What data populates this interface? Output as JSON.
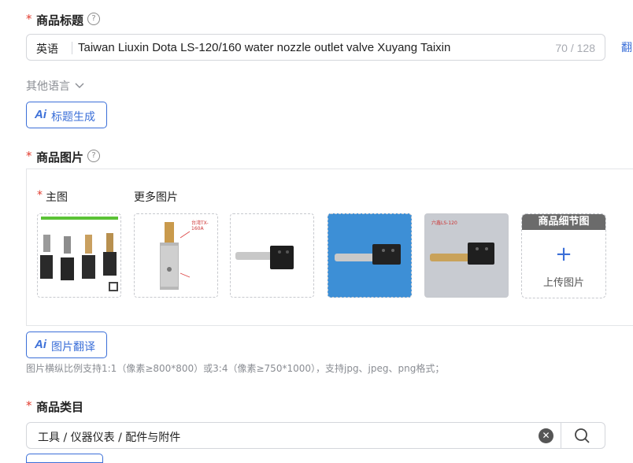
{
  "title_section": {
    "required_mark": "*",
    "label": "商品标题",
    "help_icon": "question-circle-icon",
    "language": "英语",
    "value": "Taiwan Liuxin Dota LS-120/160 water  nozzle outlet valve Xuyang Taixin",
    "counter": "70 / 128",
    "translate_link": "翻",
    "other_languages": "其他语言",
    "ai_button_label": "标题生成",
    "ai_badge": "Ai"
  },
  "image_section": {
    "required_mark": "*",
    "label": "商品图片",
    "help_icon": "question-circle-icon",
    "main_label_mark": "*",
    "main_label": "主图",
    "more_label": "更多图片",
    "images": [
      {
        "name": "main-image",
        "tag": ""
      },
      {
        "name": "more-image-1",
        "tag": "台湾TX-160A"
      },
      {
        "name": "more-image-2",
        "tag": ""
      },
      {
        "name": "more-image-3",
        "tag": ""
      },
      {
        "name": "more-image-4",
        "tag": "六鑫LS-120"
      }
    ],
    "detail_header": "商品细节图",
    "upload_label": "上传图片",
    "ai_button_label": "图片翻译",
    "ai_badge": "Ai",
    "hint": "图片横纵比例支持1:1（像素≥800*800）或3:4（像素≥750*1000），支持jpg、jpeg、png格式；"
  },
  "category_section": {
    "required_mark": "*",
    "label": "商品类目",
    "value": "工具 / 仪器仪表 / 配件与附件"
  },
  "colors": {
    "accent": "#3b6fd8",
    "required": "#e23c2f",
    "muted": "#8a8d93"
  }
}
